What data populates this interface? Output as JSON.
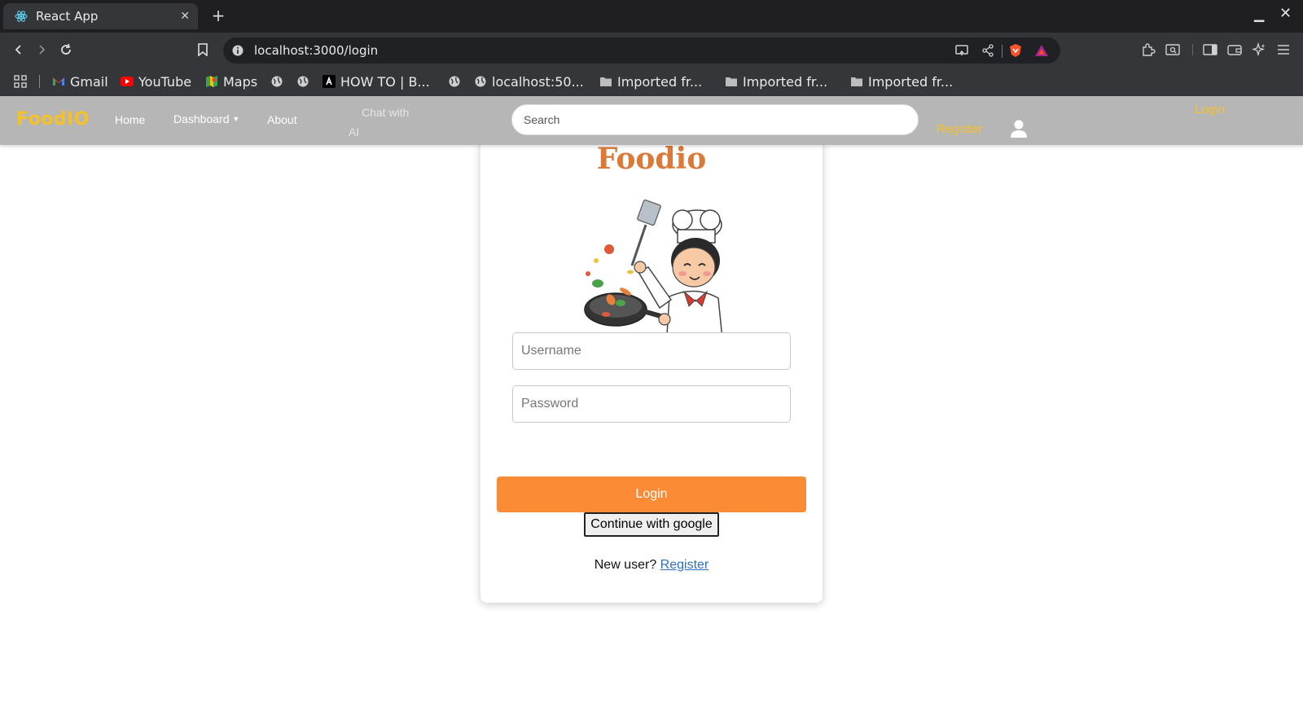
{
  "browser": {
    "tab_title": "React App",
    "url": "localhost:3000/login",
    "bookmarks": [
      {
        "label": "Gmail",
        "icon": "gmail-icon"
      },
      {
        "label": "YouTube",
        "icon": "youtube-icon"
      },
      {
        "label": "Maps",
        "icon": "maps-icon"
      },
      {
        "label": "",
        "icon": "globe-icon"
      },
      {
        "label": "",
        "icon": "globe-icon"
      },
      {
        "label": "HOW TO | B...",
        "icon": "site-icon"
      },
      {
        "label": "",
        "icon": "globe-icon"
      },
      {
        "label": "localhost:50...",
        "icon": "globe-icon"
      },
      {
        "label": "Imported fr...",
        "icon": "folder-icon"
      },
      {
        "label": "Imported fr...",
        "icon": "folder-icon"
      },
      {
        "label": "Imported fr...",
        "icon": "folder-icon"
      }
    ]
  },
  "navbar": {
    "brand": "FoodIO",
    "home": "Home",
    "dashboard": "Dashboard",
    "about": "About",
    "chat_line1": "Chat with",
    "chat_line2": "AI",
    "search_placeholder": "Search",
    "register": "Register",
    "login": "Login"
  },
  "login": {
    "title": "Foodio",
    "username_placeholder": "Username",
    "password_placeholder": "Password",
    "login_button": "Login",
    "google_button": "Continue with google",
    "new_user_text": "New user?",
    "register_link": "Register"
  },
  "colors": {
    "accent_orange": "#fc8b35",
    "brand_yellow": "#f5c028",
    "title_orange": "#d97a3a",
    "link_blue": "#2f6fc1"
  }
}
